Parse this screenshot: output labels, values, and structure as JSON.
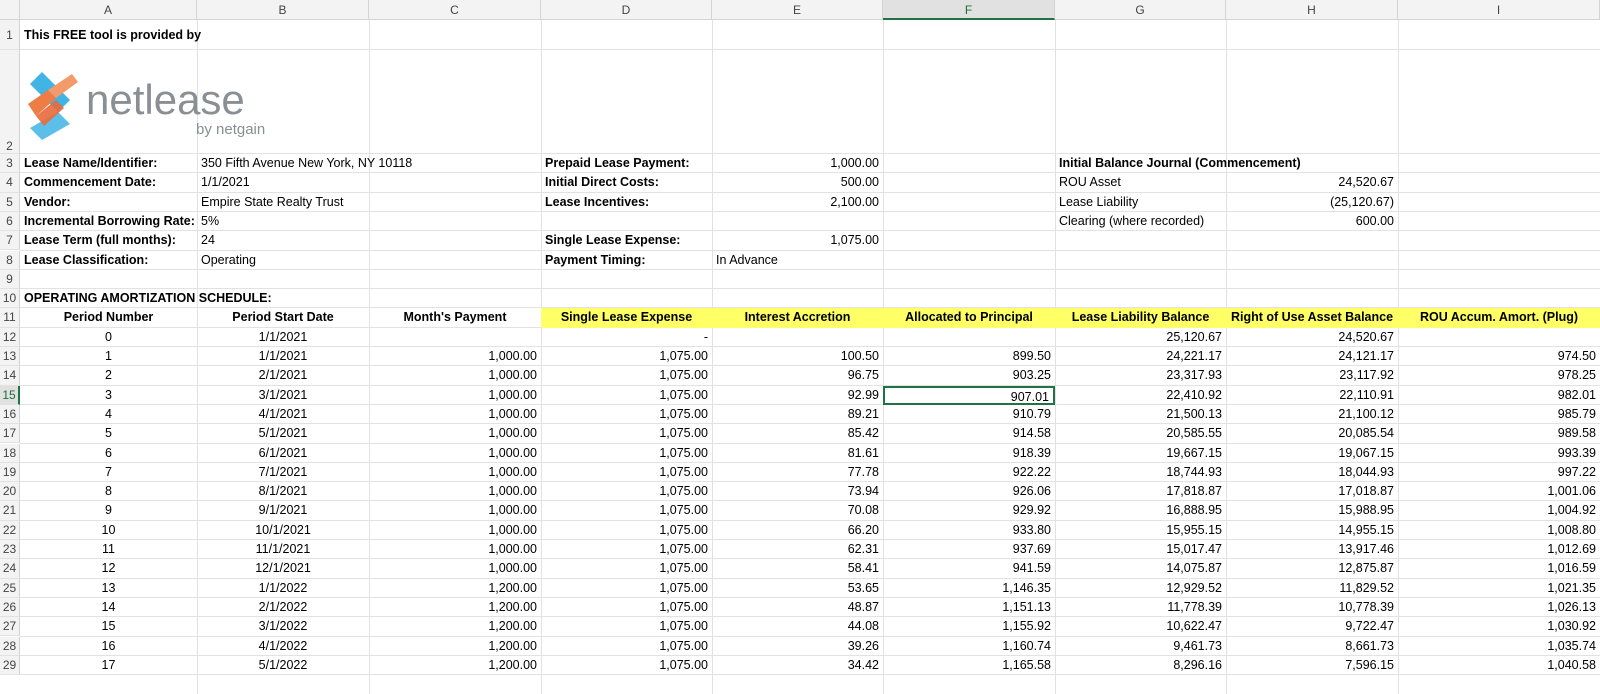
{
  "columns": [
    "A",
    "B",
    "C",
    "D",
    "E",
    "F",
    "G",
    "H",
    "I"
  ],
  "selected_column": "F",
  "selected_row": 15,
  "top_note": "This FREE tool is provided by",
  "logo": {
    "brand": "netlease",
    "tagline": "by netgain",
    "colors": {
      "orange": "#ef7b45",
      "blue": "#3fb4e5",
      "text": "#8a8f94"
    }
  },
  "lease_info": {
    "name_label": "Lease Name/Identifier:",
    "name_value": "350 Fifth Avenue New York, NY 10118",
    "commencement_label": "Commencement Date:",
    "commencement_value": "1/1/2021",
    "vendor_label": "Vendor:",
    "vendor_value": "Empire State Realty Trust",
    "ibr_label": "Incremental Borrowing Rate:",
    "ibr_value": "5%",
    "term_label": "Lease Term (full months):",
    "term_value": "24",
    "classification_label": "Lease Classification:",
    "classification_value": "Operating"
  },
  "payment_info": {
    "prepaid_label": "Prepaid Lease Payment:",
    "prepaid_value": "1,000.00",
    "idc_label": "Initial Direct Costs:",
    "idc_value": "500.00",
    "incentives_label": "Lease Incentives:",
    "incentives_value": "2,100.00",
    "single_label": "Single Lease Expense:",
    "single_value": "1,075.00",
    "timing_label": "Payment Timing:",
    "timing_value": "In Advance"
  },
  "journal": {
    "title": "Initial Balance Journal (Commencement)",
    "rou_label": "ROU Asset",
    "rou_value": "24,520.67",
    "liability_label": "Lease Liability",
    "liability_value": "(25,120.67)",
    "clearing_label": "Clearing (where recorded)",
    "clearing_value": "600.00"
  },
  "schedule_title": "OPERATING AMORTIZATION SCHEDULE:",
  "schedule_headers": [
    "Period Number",
    "Period Start Date",
    "Month's Payment",
    "Single Lease Expense",
    "Interest Accretion",
    "Allocated to Principal",
    "Lease Liability Balance",
    "Right of Use Asset Balance",
    "ROU Accum. Amort. (Plug)"
  ],
  "schedule_rows": [
    [
      "0",
      "1/1/2021",
      "",
      "-",
      "",
      "",
      "25,120.67",
      "24,520.67",
      ""
    ],
    [
      "1",
      "1/1/2021",
      "1,000.00",
      "1,075.00",
      "100.50",
      "899.50",
      "24,221.17",
      "24,121.17",
      "974.50"
    ],
    [
      "2",
      "2/1/2021",
      "1,000.00",
      "1,075.00",
      "96.75",
      "903.25",
      "23,317.93",
      "23,117.92",
      "978.25"
    ],
    [
      "3",
      "3/1/2021",
      "1,000.00",
      "1,075.00",
      "92.99",
      "907.01",
      "22,410.92",
      "22,110.91",
      "982.01"
    ],
    [
      "4",
      "4/1/2021",
      "1,000.00",
      "1,075.00",
      "89.21",
      "910.79",
      "21,500.13",
      "21,100.12",
      "985.79"
    ],
    [
      "5",
      "5/1/2021",
      "1,000.00",
      "1,075.00",
      "85.42",
      "914.58",
      "20,585.55",
      "20,085.54",
      "989.58"
    ],
    [
      "6",
      "6/1/2021",
      "1,000.00",
      "1,075.00",
      "81.61",
      "918.39",
      "19,667.15",
      "19,067.15",
      "993.39"
    ],
    [
      "7",
      "7/1/2021",
      "1,000.00",
      "1,075.00",
      "77.78",
      "922.22",
      "18,744.93",
      "18,044.93",
      "997.22"
    ],
    [
      "8",
      "8/1/2021",
      "1,000.00",
      "1,075.00",
      "73.94",
      "926.06",
      "17,818.87",
      "17,018.87",
      "1,001.06"
    ],
    [
      "9",
      "9/1/2021",
      "1,000.00",
      "1,075.00",
      "70.08",
      "929.92",
      "16,888.95",
      "15,988.95",
      "1,004.92"
    ],
    [
      "10",
      "10/1/2021",
      "1,000.00",
      "1,075.00",
      "66.20",
      "933.80",
      "15,955.15",
      "14,955.15",
      "1,008.80"
    ],
    [
      "11",
      "11/1/2021",
      "1,000.00",
      "1,075.00",
      "62.31",
      "937.69",
      "15,017.47",
      "13,917.46",
      "1,012.69"
    ],
    [
      "12",
      "12/1/2021",
      "1,000.00",
      "1,075.00",
      "58.41",
      "941.59",
      "14,075.87",
      "12,875.87",
      "1,016.59"
    ],
    [
      "13",
      "1/1/2022",
      "1,200.00",
      "1,075.00",
      "53.65",
      "1,146.35",
      "12,929.52",
      "11,829.52",
      "1,021.35"
    ],
    [
      "14",
      "2/1/2022",
      "1,200.00",
      "1,075.00",
      "48.87",
      "1,151.13",
      "11,778.39",
      "10,778.39",
      "1,026.13"
    ],
    [
      "15",
      "3/1/2022",
      "1,200.00",
      "1,075.00",
      "44.08",
      "1,155.92",
      "10,622.47",
      "9,722.47",
      "1,030.92"
    ],
    [
      "16",
      "4/1/2022",
      "1,200.00",
      "1,075.00",
      "39.26",
      "1,160.74",
      "9,461.73",
      "8,661.73",
      "1,035.74"
    ],
    [
      "17",
      "5/1/2022",
      "1,200.00",
      "1,075.00",
      "34.42",
      "1,165.58",
      "8,296.16",
      "7,596.15",
      "1,040.58"
    ]
  ]
}
